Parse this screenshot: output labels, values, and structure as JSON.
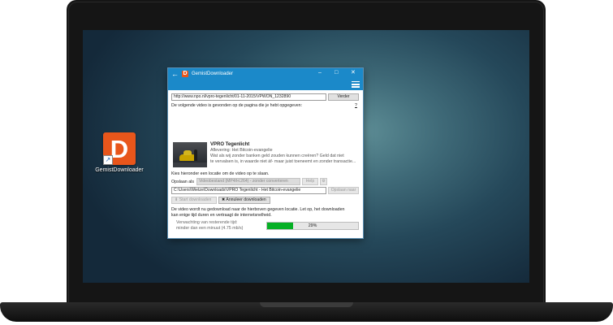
{
  "desktop": {
    "icon_label": "GemistDownloader",
    "icon_letter": "D"
  },
  "window": {
    "title": "GemistDownloader",
    "app_icon_letter": "D",
    "controls": {
      "minimize": "–",
      "maximize": "□",
      "close": "✕"
    }
  },
  "url_row": {
    "value": "http://www.npo.nl/vpro-tegenlicht/01-11-2015/VPWON_1232890",
    "button": "Verder"
  },
  "found_text": "De volgende video is gevonden op de pagina die je hebt opgegeven:",
  "help_mark": "?",
  "video": {
    "title": "VPRO Tegenlicht",
    "episode": "Aflevering: Het Bitcoin-evangelie",
    "description_1": "Wat als wij zonder banken geld zouden kunnen creëren? Geld dat niet",
    "description_2": "te vervalsen is, in waarde niet áf- maar juist toeneemt en zonder transactie..."
  },
  "location_text": "Kies hieronder een locatie om de video op te slaan.",
  "save_as": {
    "label": "Opslaan als",
    "format": "Videobestand (MP4/H.264) - zonder converteren",
    "help_button": "Help",
    "path": "C:\\Users\\Wietze\\Downloads\\VPRO Tegenlicht - Het Bitcoin-evangelie",
    "browse_button": "Opslaan naar"
  },
  "actions": {
    "start": "Start downloaden",
    "cancel": "Annuleer downloaden"
  },
  "status": {
    "line_1": "De video wordt nu gedownload naar de hierboven gegeven locatie. Let op, het downloaden",
    "line_2": "kan enige tijd duren en vertraagt de internetsnelheid.",
    "remaining_label": "Verwachting van resterende tijd:",
    "remaining_value": "minder dan een minuut (4.75 mb/s)",
    "progress_fraction": 0.29,
    "progress_text": "29%"
  },
  "colors": {
    "titlebar": "#1b89c9",
    "accent_orange": "#e8561b",
    "progress_green": "#06b025"
  },
  "icons": {
    "back": "←",
    "start": "⬇",
    "cancel": "✖",
    "shortcut": "↗"
  }
}
